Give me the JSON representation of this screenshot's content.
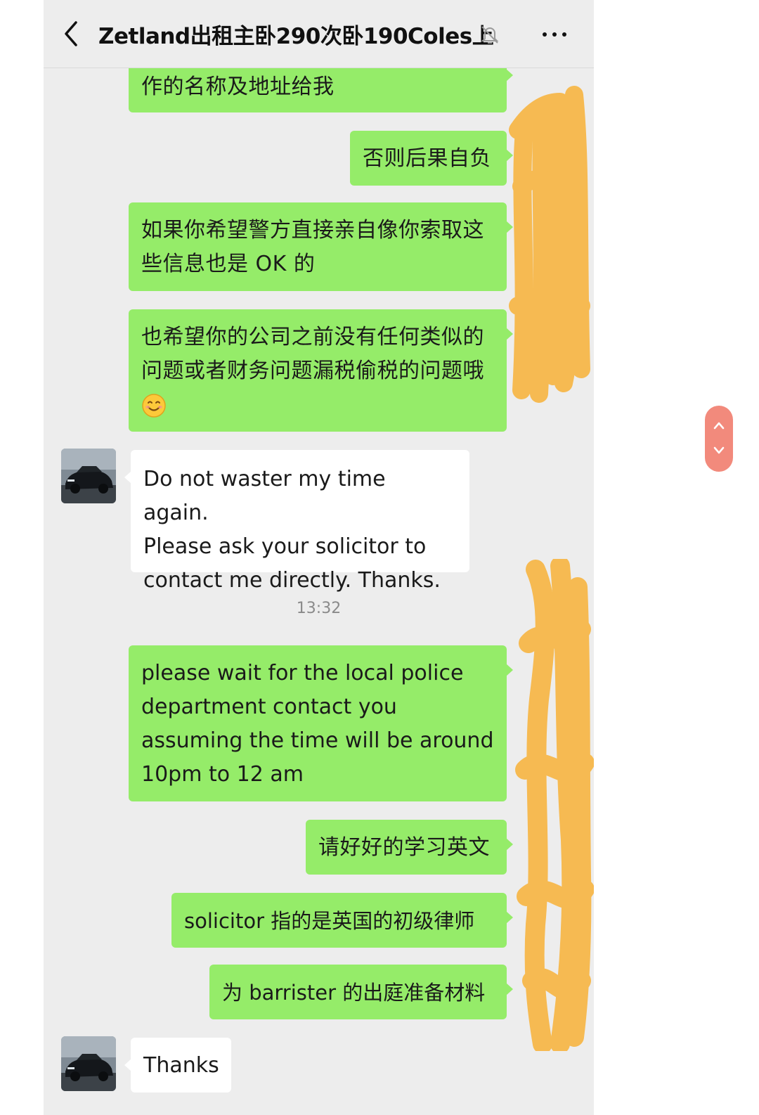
{
  "header": {
    "title": "Zetland出租主卧290次卧190Coles上"
  },
  "messages": [
    {
      "text": "作的名称及地址给我"
    },
    {
      "text": "否则后果自负"
    },
    {
      "line1": "如果你希望警方直接亲自像你索取这",
      "line2": "些信息也是 OK 的"
    },
    {
      "line1": "也希望你的公司之前没有任何类似的",
      "line2": "问题或者财务问题漏税偷税的问题哦"
    },
    {
      "line1": "Do not waster my time again.",
      "line2": "Please ask your solicitor to",
      "line3": "contact me directly. Thanks."
    },
    {
      "line1": "please wait for the local police",
      "line2": "department contact you",
      "line3": "assuming the time will be around",
      "line4": "10pm to 12 am"
    },
    {
      "text": "请好好的学习英文"
    },
    {
      "text": "solicitor 指的是英国的初级律师"
    },
    {
      "text": "为 barrister 的出庭准备材料"
    },
    {
      "text": "Thanks"
    }
  ],
  "timestamp": "13:32",
  "icons": {
    "back": "back-chevron-icon",
    "mute": "mute-bell-icon",
    "more": "more-dots-icon",
    "emoji": "smiling-face-emoji-icon",
    "scroll_up": "chevron-up-icon",
    "scroll_down": "chevron-down-icon"
  },
  "colors": {
    "sent_bubble": "#95ec69",
    "received_bubble": "#ffffff",
    "chat_background": "#ededed",
    "scribble": "#f7b84a",
    "scroll_control": "#f28a7c"
  }
}
